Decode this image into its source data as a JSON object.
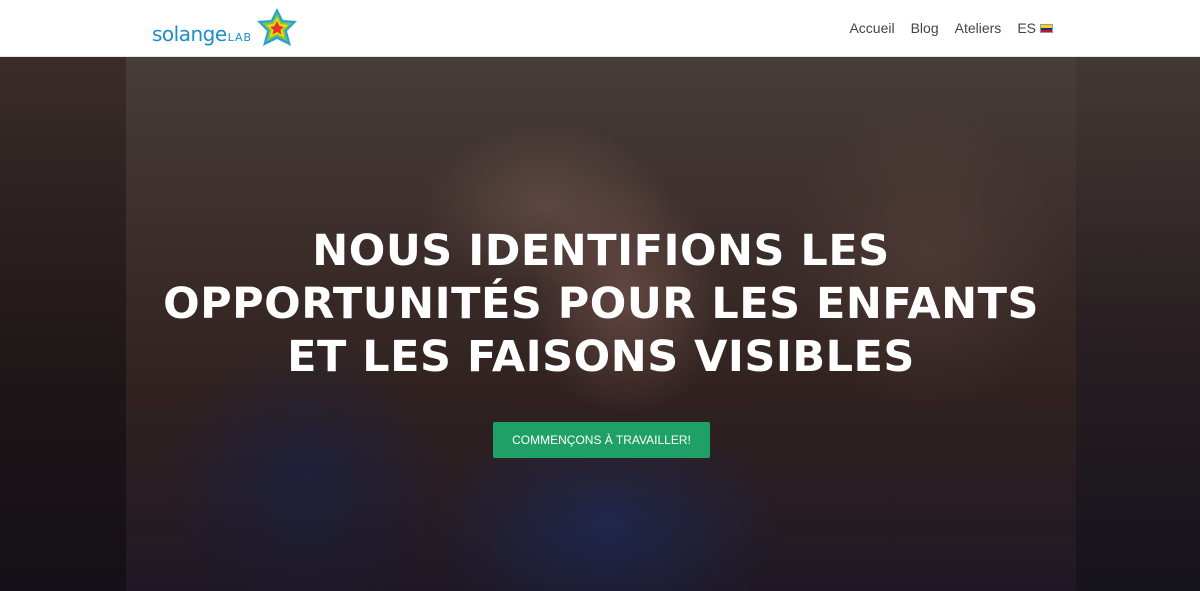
{
  "brand": {
    "name": "solange",
    "suffix": "LAB",
    "logo_icon": "star-logo-icon"
  },
  "nav": {
    "items": [
      {
        "label": "Accueil"
      },
      {
        "label": "Blog"
      },
      {
        "label": "Ateliers"
      }
    ],
    "language": {
      "label": "ES",
      "flag_icon": "colombia-flag-icon"
    }
  },
  "hero": {
    "title": "NOUS IDENTIFIONS LES OPPORTUNITÉS POUR LES ENFANTS ET LES FAISONS VISIBLES",
    "cta_label": "COMMENÇONS À TRAVAILLER!"
  },
  "colors": {
    "accent": "#1fa067",
    "brand": "#1a8fc9"
  }
}
